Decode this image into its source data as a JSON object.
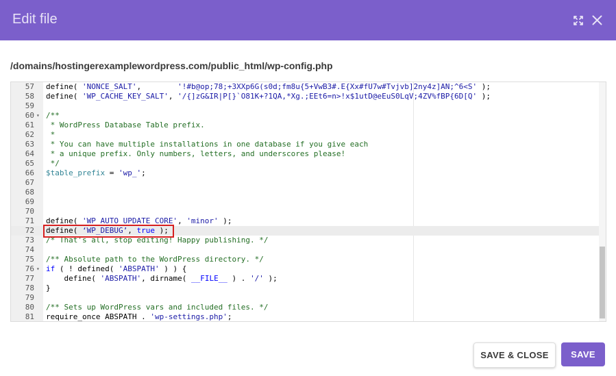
{
  "dialog": {
    "title": "Edit file",
    "file_path": "/domains/hostingerexamplewordpress.com/public_html/wp-config.php"
  },
  "icons": {
    "expand": "expand-icon",
    "close": "close-icon",
    "fold": "fold-arrow-icon"
  },
  "colors": {
    "header": "#7b5fcb",
    "primary_button": "#7b5fcb",
    "highlight_border": "#d61f1f"
  },
  "editor": {
    "active_line": "72",
    "lines": [
      {
        "n": "57",
        "fold": false,
        "tokens": [
          {
            "t": "define( "
          },
          {
            "t": "'NONCE_SALT'",
            "c": "s"
          },
          {
            "t": ",        "
          },
          {
            "t": "'!#b@op;78;+3XXp6G(s0d;fm8u{5+VwB3#.E{Xx#fU7w#Tvjvb]2ny4z]AN;^6<S'",
            "c": "s"
          },
          {
            "t": " );"
          }
        ]
      },
      {
        "n": "58",
        "fold": false,
        "tokens": [
          {
            "t": "define( "
          },
          {
            "t": "'WP_CACHE_KEY_SALT'",
            "c": "s"
          },
          {
            "t": ", "
          },
          {
            "t": "'/{]zG&IR|P[}`O81K+?1QA,*Xg.;EEt6=n>!x$1utD@eEuS0LqV;4ZV%fBP{6D[Q'",
            "c": "s"
          },
          {
            "t": " );"
          }
        ]
      },
      {
        "n": "59",
        "fold": false,
        "tokens": []
      },
      {
        "n": "60",
        "fold": true,
        "tokens": [
          {
            "t": "/**",
            "c": "c"
          }
        ]
      },
      {
        "n": "61",
        "fold": false,
        "tokens": [
          {
            "t": " * WordPress Database Table prefix.",
            "c": "c"
          }
        ]
      },
      {
        "n": "62",
        "fold": false,
        "tokens": [
          {
            "t": " *",
            "c": "c"
          }
        ]
      },
      {
        "n": "63",
        "fold": false,
        "tokens": [
          {
            "t": " * You can have multiple installations in one database if you give each",
            "c": "c"
          }
        ]
      },
      {
        "n": "64",
        "fold": false,
        "tokens": [
          {
            "t": " * a unique prefix. Only numbers, letters, and underscores please!",
            "c": "c"
          }
        ]
      },
      {
        "n": "65",
        "fold": false,
        "tokens": [
          {
            "t": " */",
            "c": "c"
          }
        ]
      },
      {
        "n": "66",
        "fold": false,
        "tokens": [
          {
            "t": "$table_prefix",
            "c": "v"
          },
          {
            "t": " = "
          },
          {
            "t": "'wp_'",
            "c": "s"
          },
          {
            "t": ";"
          }
        ]
      },
      {
        "n": "67",
        "fold": false,
        "tokens": []
      },
      {
        "n": "68",
        "fold": false,
        "tokens": []
      },
      {
        "n": "69",
        "fold": false,
        "tokens": []
      },
      {
        "n": "70",
        "fold": false,
        "tokens": []
      },
      {
        "n": "71",
        "fold": false,
        "tokens": [
          {
            "t": "define( "
          },
          {
            "t": "'WP_AUTO_UPDATE_CORE'",
            "c": "s"
          },
          {
            "t": ", "
          },
          {
            "t": "'minor'",
            "c": "s"
          },
          {
            "t": " );"
          }
        ]
      },
      {
        "n": "72",
        "fold": false,
        "tokens": [
          {
            "t": "define( "
          },
          {
            "t": "‘WP_DEBUG’",
            "c": "s"
          },
          {
            "t": ", "
          },
          {
            "t": "true",
            "c": "k"
          },
          {
            "t": " );"
          }
        ]
      },
      {
        "n": "73",
        "fold": false,
        "tokens": [
          {
            "t": "/* That's all, stop editing! Happy publishing. */",
            "c": "c"
          }
        ]
      },
      {
        "n": "74",
        "fold": false,
        "tokens": []
      },
      {
        "n": "75",
        "fold": false,
        "tokens": [
          {
            "t": "/** Absolute path to the WordPress directory. */",
            "c": "c"
          }
        ]
      },
      {
        "n": "76",
        "fold": true,
        "tokens": [
          {
            "t": "if",
            "c": "k"
          },
          {
            "t": " ( ! defined( "
          },
          {
            "t": "'ABSPATH'",
            "c": "s"
          },
          {
            "t": " ) ) {"
          }
        ]
      },
      {
        "n": "77",
        "fold": false,
        "tokens": [
          {
            "t": "    define( "
          },
          {
            "t": "'ABSPATH'",
            "c": "s"
          },
          {
            "t": ", dirname( "
          },
          {
            "t": "__FILE__",
            "c": "cb"
          },
          {
            "t": " ) . "
          },
          {
            "t": "'/'",
            "c": "s"
          },
          {
            "t": " );"
          }
        ]
      },
      {
        "n": "78",
        "fold": false,
        "tokens": [
          {
            "t": "}"
          }
        ]
      },
      {
        "n": "79",
        "fold": false,
        "tokens": []
      },
      {
        "n": "80",
        "fold": false,
        "tokens": [
          {
            "t": "/** Sets up WordPress vars and included files. */",
            "c": "c"
          }
        ]
      },
      {
        "n": "81",
        "fold": false,
        "tokens": [
          {
            "t": "require_once ABSPATH . "
          },
          {
            "t": "'wp-settings.php'",
            "c": "s"
          },
          {
            "t": ";"
          }
        ]
      }
    ]
  },
  "buttons": {
    "save_close": "SAVE & CLOSE",
    "save": "SAVE"
  }
}
